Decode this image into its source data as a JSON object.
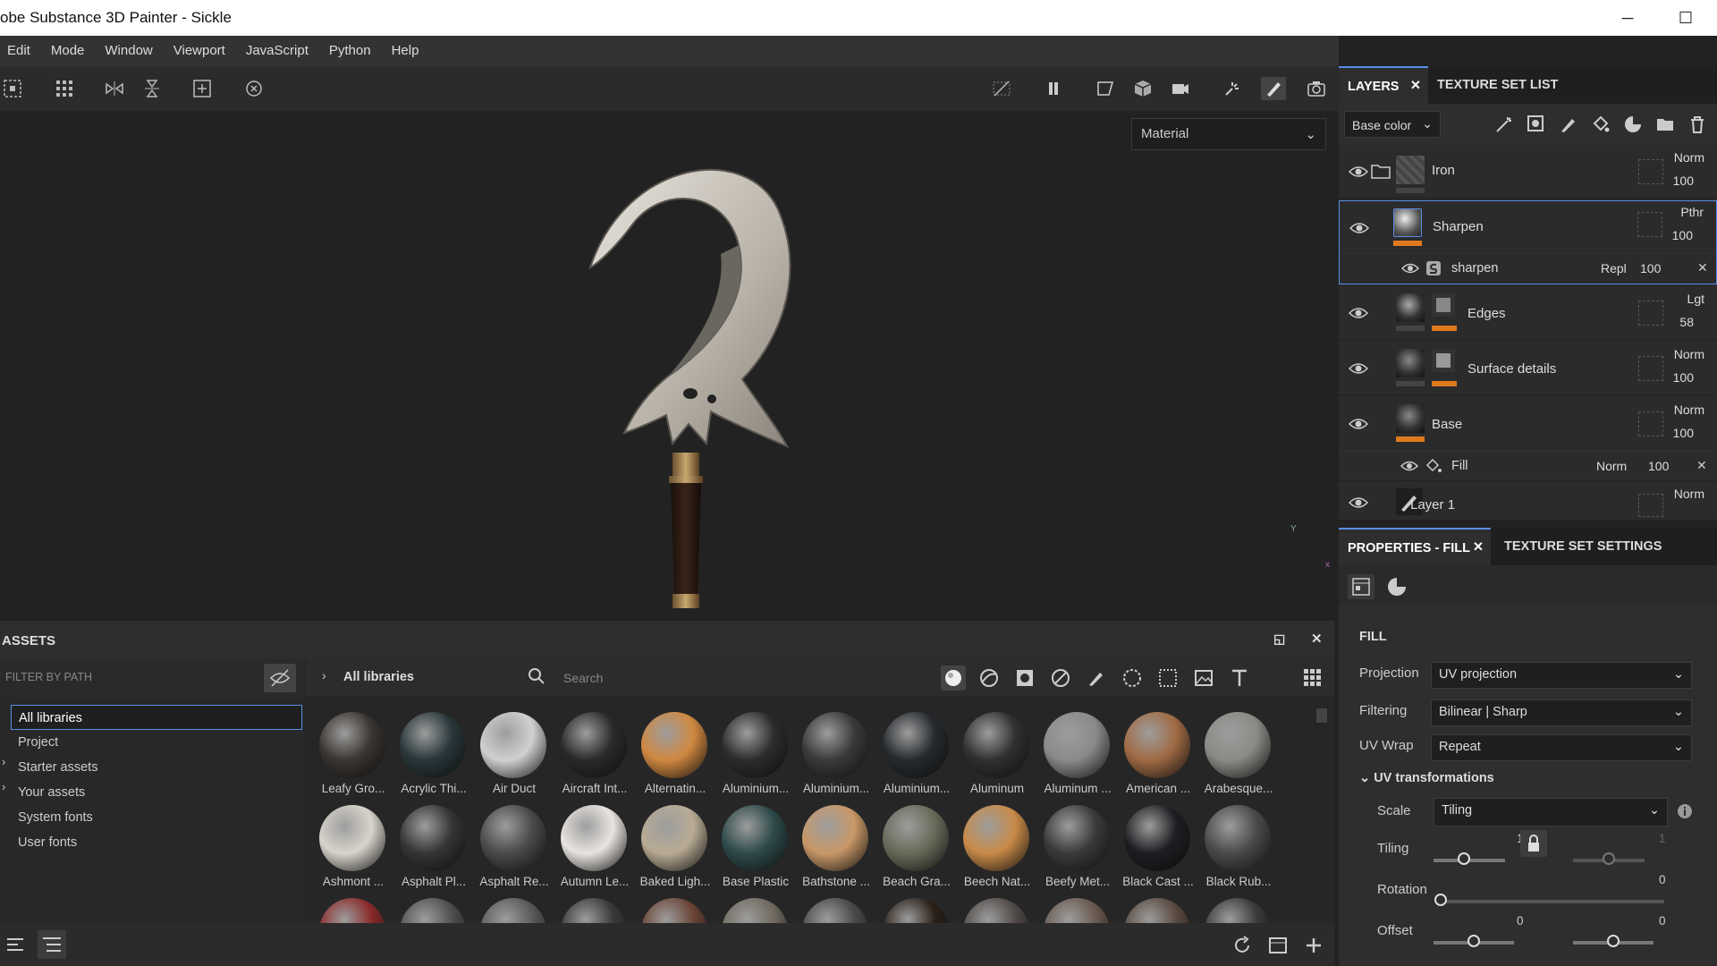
{
  "window": {
    "title": "obe Substance 3D Painter - Sickle",
    "minimize": "─",
    "maximize": "☐"
  },
  "menu": [
    "Edit",
    "Mode",
    "Window",
    "Viewport",
    "JavaScript",
    "Python",
    "Help"
  ],
  "viewport": {
    "material_mode": "Material",
    "axis_y": "Y",
    "axis_x": "x"
  },
  "layers_panel": {
    "tabs": [
      "LAYERS",
      "TEXTURE SET LIST"
    ],
    "channel": "Base color",
    "layers": [
      {
        "name": "Iron",
        "blend": "Norm",
        "opacity": "100",
        "type": "folder"
      },
      {
        "name": "Sharpen",
        "blend": "Pthr",
        "opacity": "100",
        "type": "fill",
        "selected": true,
        "effect": {
          "name": "sharpen",
          "blend": "Repl",
          "opacity": "100"
        }
      },
      {
        "name": "Edges",
        "blend": "Lgt",
        "opacity": "58",
        "type": "fill-mask"
      },
      {
        "name": "Surface details",
        "blend": "Norm",
        "opacity": "100",
        "type": "fill-mask"
      },
      {
        "name": "Base",
        "blend": "Norm",
        "opacity": "100",
        "type": "fill",
        "effect": {
          "name": "Fill",
          "blend": "Norm",
          "opacity": "100"
        }
      },
      {
        "name": "Layer 1",
        "blend": "Norm",
        "type": "paint"
      }
    ]
  },
  "properties_panel": {
    "tabs": [
      "PROPERTIES - FILL",
      "TEXTURE SET SETTINGS"
    ],
    "section": "FILL",
    "projection": {
      "label": "Projection",
      "value": "UV projection"
    },
    "filtering": {
      "label": "Filtering",
      "value": "Bilinear | Sharp"
    },
    "uv_wrap": {
      "label": "UV Wrap",
      "value": "Repeat"
    },
    "uv_transformations": "UV transformations",
    "scale": {
      "label": "Scale",
      "value": "Tiling"
    },
    "tiling": {
      "label": "Tiling",
      "u": "1",
      "v": "1",
      "u_fraction": 0.42,
      "v_fraction": 0.5
    },
    "rotation": {
      "label": "Rotation",
      "value": "0",
      "fraction": 0.0
    },
    "offset": {
      "label": "Offset",
      "u": "0",
      "v": "0",
      "u_fraction": 0.5,
      "v_fraction": 0.5
    }
  },
  "assets": {
    "title": "ASSETS",
    "filter_placeholder": "FILTER BY PATH",
    "breadcrumb": "All libraries",
    "search_placeholder": "Search",
    "tree": [
      {
        "label": "All libraries",
        "selected": true,
        "expandable": false
      },
      {
        "label": "Project",
        "expandable": false
      },
      {
        "label": "Starter assets",
        "expandable": true
      },
      {
        "label": "Your assets",
        "expandable": true
      },
      {
        "label": "System fonts",
        "expandable": false
      },
      {
        "label": "User fonts",
        "expandable": false
      }
    ],
    "row1": [
      "Leafy Gro...",
      "Acrylic Thi...",
      "Air Duct",
      "Aircraft Int...",
      "Alternatin...",
      "Aluminium...",
      "Aluminium...",
      "Aluminium...",
      "Aluminum",
      "Aluminum ...",
      "American ...",
      "Arabesque..."
    ],
    "row2": [
      "Ashmont ...",
      "Asphalt Pl...",
      "Asphalt Re...",
      "Autumn Le...",
      "Baked Ligh...",
      "Base Plastic",
      "Bathstone ...",
      "Beach Gra...",
      "Beech Nat...",
      "Beefy Met...",
      "Black Cast ...",
      "Black Rub..."
    ],
    "colors_row1": [
      "#3a3530",
      "#28363a",
      "#d0d0d0",
      "#2a2a2a",
      "#d08840",
      "#2c2c2e",
      "#3a3a3c",
      "#262a2e",
      "#303032",
      "#8a8a8a",
      "#a06a44",
      "#8a8a86"
    ],
    "colors_row2": [
      "#d8d4cc",
      "#353535",
      "#4a4a4c",
      "#e8e4e0",
      "#b8ab94",
      "#2e4a4a",
      "#c89868",
      "#6a6a5a",
      "#c88a48",
      "#3a3a3a",
      "#1e1e22",
      "#4a4a4a"
    ],
    "colors_row3": [
      "#8a2a2a",
      "#505050",
      "#5a5a58",
      "#3a3a3a",
      "#6a4436",
      "#706a60",
      "#4a4a4a",
      "#2a2018",
      "#504a48",
      "#6a5a50",
      "#5a4a40",
      "#3a3a3a"
    ]
  }
}
